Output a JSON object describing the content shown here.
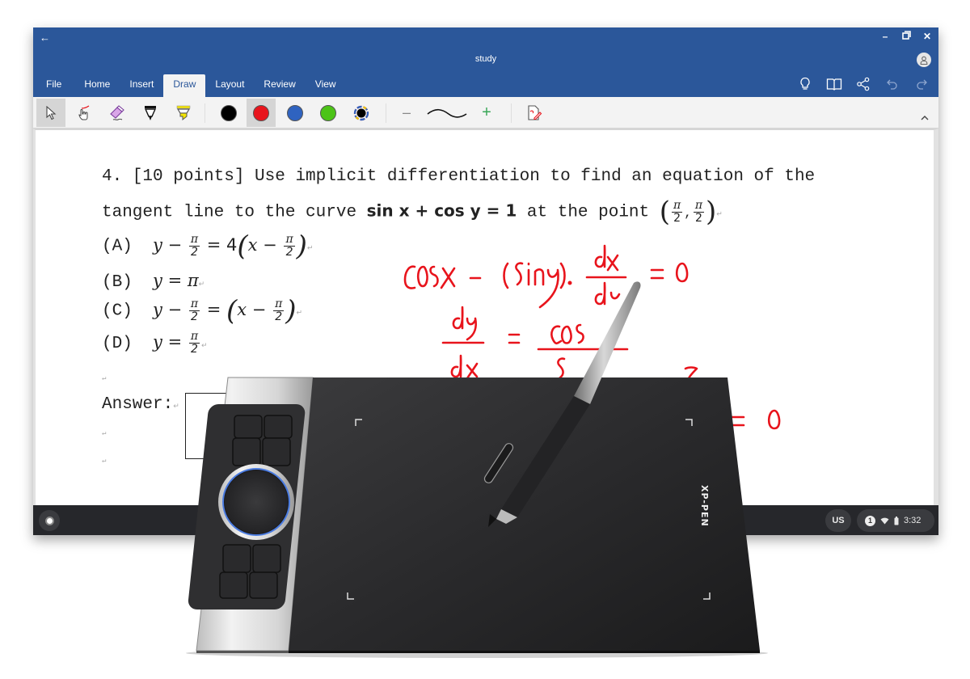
{
  "window": {
    "title": "study",
    "controls": {
      "back": "←",
      "minimize": "–",
      "restore": "⧉",
      "close": "✕"
    },
    "tabs": [
      {
        "label": "File",
        "active": false
      },
      {
        "label": "Home",
        "active": false
      },
      {
        "label": "Insert",
        "active": false
      },
      {
        "label": "Draw",
        "active": true
      },
      {
        "label": "Layout",
        "active": false
      },
      {
        "label": "Review",
        "active": false
      },
      {
        "label": "View",
        "active": false
      }
    ],
    "right_icons": [
      "lightbulb-icon",
      "book-icon",
      "share-icon",
      "undo-icon",
      "redo-icon"
    ]
  },
  "ribbon": {
    "tools": [
      "select-tool",
      "draw-with-touch",
      "eraser",
      "black-pen",
      "yellow-highlighter"
    ],
    "colors": [
      {
        "name": "black",
        "hex": "#000000",
        "selected": false
      },
      {
        "name": "red",
        "hex": "#e8141c",
        "selected": true
      },
      {
        "name": "blue",
        "hex": "#2f63c0",
        "selected": false
      },
      {
        "name": "green",
        "hex": "#4cc417",
        "selected": false
      },
      {
        "name": "custom",
        "hex": "#000000",
        "selected": false
      }
    ],
    "thickness_minus": "–",
    "thickness_plus": "+",
    "ink_to_shape": "ink-editor"
  },
  "document": {
    "line1": "4. [10 points] Use implicit differentiation to find an equation of the",
    "line2_prefix": "tangent line to the curve ",
    "line2_math": "sin x + cos y = 1",
    "line2_mid": " at the point ",
    "point": "(π/2, π/2)",
    "options": [
      {
        "label": "(A)",
        "expr": "y − π/2 = 4(x − π/2)"
      },
      {
        "label": "(B)",
        "expr": "y = π"
      },
      {
        "label": "(C)",
        "expr": "y − π/2 = (x − π/2)"
      },
      {
        "label": "(D)",
        "expr": "y = π/2"
      }
    ],
    "answer_label": "Answer:",
    "pi": "π",
    "two": "2",
    "four": "4",
    "para_mark": "↵"
  },
  "handwriting": {
    "color": "#e8141c",
    "lines": [
      "cosx − (siny)·dx/dy = 0",
      "dy/dx = cosx/siny",
      "= 0"
    ]
  },
  "shelf": {
    "ime": "US",
    "notifications": "1",
    "time": "3:32"
  },
  "tablet": {
    "brand": "XP-PEN"
  }
}
